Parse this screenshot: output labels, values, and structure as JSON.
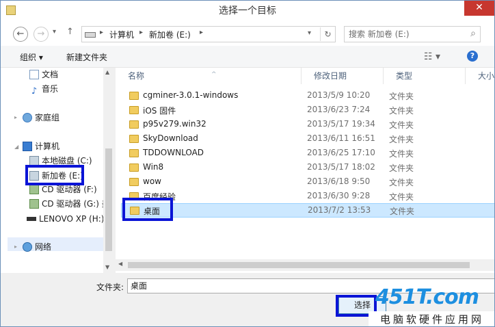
{
  "window": {
    "title": "选择一个目标",
    "close_glyph": "✕"
  },
  "nav": {
    "back_glyph": "←",
    "forward_glyph": "→",
    "up_glyph": "↑",
    "address": [
      "计算机",
      "新加卷 (E:)"
    ],
    "search_placeholder": "搜索 新加卷 (E:)"
  },
  "toolbar": {
    "organize": "组织 ▾",
    "new_folder": "新建文件夹",
    "help_glyph": "?"
  },
  "sidebar": {
    "items": [
      {
        "label": "文档",
        "icon": "document-icon"
      },
      {
        "label": "音乐",
        "icon": "music-icon"
      },
      {
        "label": "家庭组",
        "icon": "homegroup-icon"
      },
      {
        "label": "计算机",
        "icon": "computer-icon"
      },
      {
        "label": "本地磁盘 (C:)",
        "icon": "drive-icon"
      },
      {
        "label": "新加卷 (E:)",
        "icon": "drive-icon"
      },
      {
        "label": "CD 驱动器 (F:)",
        "icon": "cd-drive-icon"
      },
      {
        "label": "CD 驱动器 (G:) 美",
        "icon": "cd-drive-icon"
      },
      {
        "label": "LENOVO XP (H:)",
        "icon": "usb-drive-icon"
      },
      {
        "label": "网络",
        "icon": "network-icon"
      }
    ]
  },
  "columns": {
    "name": "名称",
    "date": "修改日期",
    "type": "类型",
    "size": "大小"
  },
  "files": [
    {
      "name": "cgminer-3.0.1-windows",
      "date": "2013/5/9 10:20",
      "type": "文件夹"
    },
    {
      "name": "iOS 固件",
      "date": "2013/6/23 7:24",
      "type": "文件夹"
    },
    {
      "name": "p95v279.win32",
      "date": "2013/5/17 19:34",
      "type": "文件夹"
    },
    {
      "name": "SkyDownload",
      "date": "2013/6/11 16:51",
      "type": "文件夹"
    },
    {
      "name": "TDDOWNLOAD",
      "date": "2013/6/25 17:10",
      "type": "文件夹"
    },
    {
      "name": "Win8",
      "date": "2013/5/17 18:02",
      "type": "文件夹"
    },
    {
      "name": "wow",
      "date": "2013/6/18 9:50",
      "type": "文件夹"
    },
    {
      "name": "百度经验",
      "date": "2013/6/30 9:28",
      "type": "文件夹"
    },
    {
      "name": "桌面",
      "date": "2013/7/2 13:53",
      "type": "文件夹"
    }
  ],
  "footer": {
    "folder_label": "文件夹:",
    "folder_value": "桌面",
    "choose_button": "选择"
  },
  "watermark": {
    "logo_text": "451T.com",
    "subtitle": "电脑软硬件应用网"
  },
  "colors": {
    "highlight": "#0a14d6",
    "selection": "#cce8ff",
    "accent": "#2a6fcf"
  }
}
